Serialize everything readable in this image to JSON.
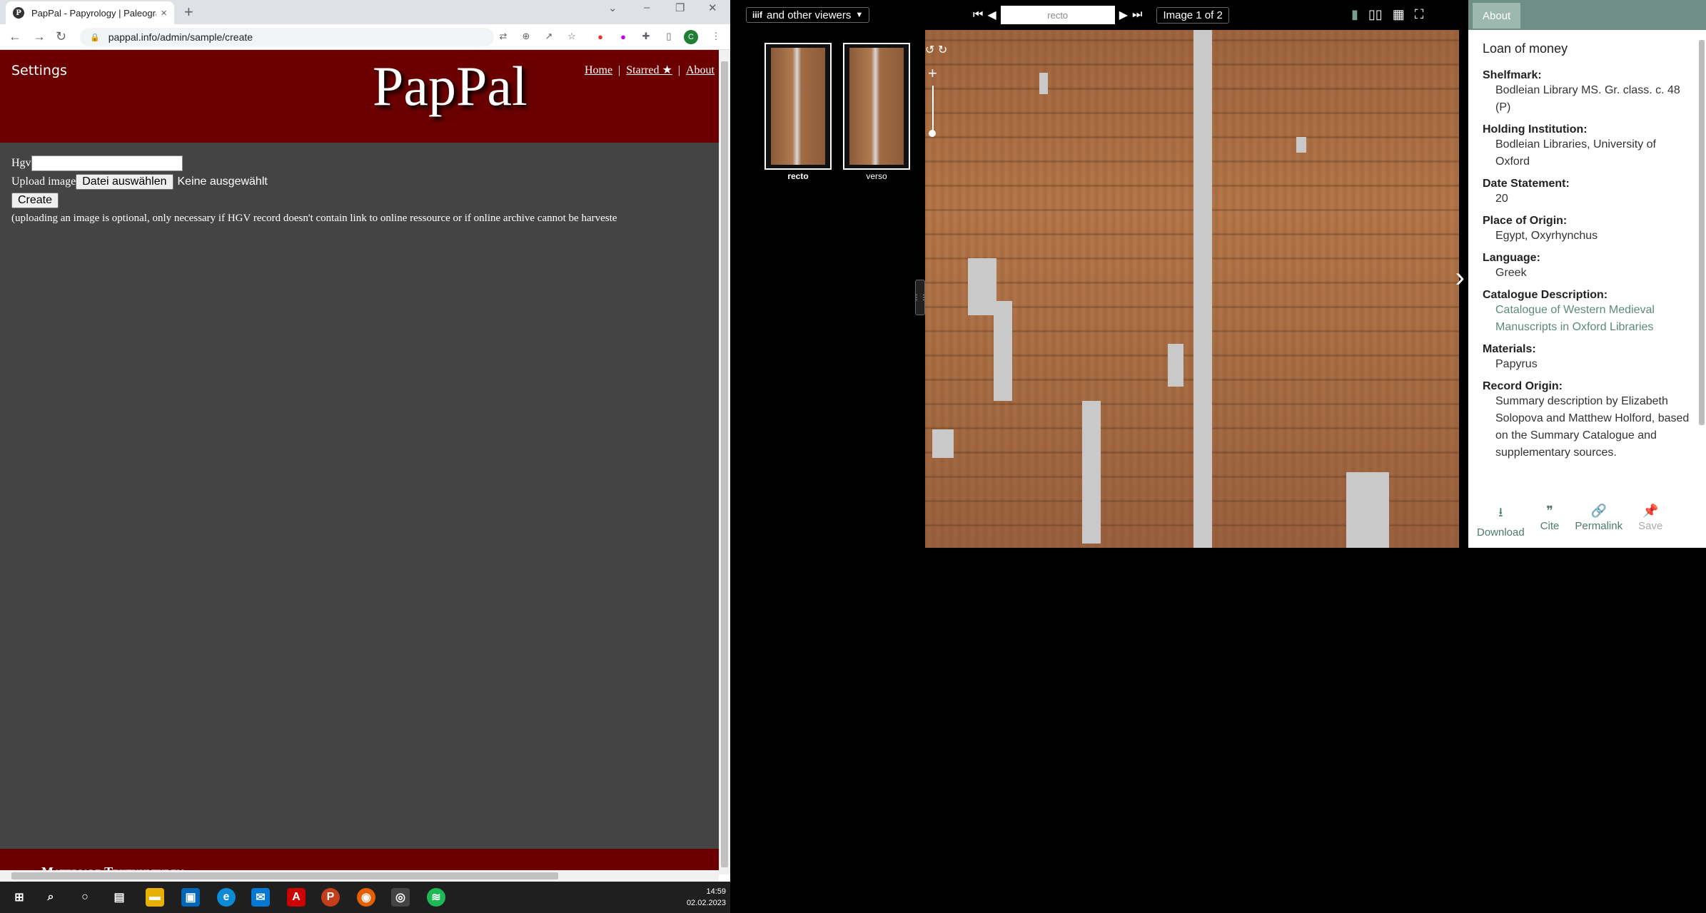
{
  "browser": {
    "tab_title": "PapPal - Papyrology | Paleograph...",
    "tab_close": "×",
    "new_tab": "+",
    "url": "pappal.info/admin/sample/create",
    "favicon_letter": "P",
    "profile_initial": "C"
  },
  "site": {
    "settings_label": "Settings",
    "logo_text": "PapPal",
    "nav": {
      "home": "Home",
      "starred": "Starred ★",
      "about": "About",
      "separator": "|"
    },
    "form": {
      "hgv_label": "Hgv",
      "hgv_value": "",
      "upload_label": "Upload image",
      "file_button": "Datei auswählen",
      "file_status": "Keine ausgewählt",
      "create_button": "Create",
      "note": "(uploading an image is optional, only necessary if HGV record doesn't contain link to online ressource or if online archive cannot be harveste"
    },
    "footer_text": "Materiale Textkulturen"
  },
  "taskbar": {
    "time": "14:59",
    "date": "02.02.2023"
  },
  "viewer": {
    "viewers_label": "and other viewers",
    "page_label": "recto",
    "image_count": "Image 1 of 2",
    "thumbnails": [
      {
        "label": "recto",
        "selected": true
      },
      {
        "label": "verso",
        "selected": false
      }
    ],
    "side_tab": "About",
    "manuscript_title": "Loan of money",
    "metadata": [
      {
        "label": "Shelfmark:",
        "value": "Bodleian Library MS. Gr. class. c. 48 (P)"
      },
      {
        "label": "Holding Institution:",
        "value": "Bodleian Libraries, University of Oxford"
      },
      {
        "label": "Date Statement:",
        "value": "20"
      },
      {
        "label": "Place of Origin:",
        "value": "Egypt, Oxyrhynchus"
      },
      {
        "label": "Language:",
        "value": "Greek"
      },
      {
        "label": "Catalogue Description:",
        "value": "Catalogue of Western Medieval Manuscripts in Oxford Libraries"
      },
      {
        "label": "Materials:",
        "value": "Papyrus"
      },
      {
        "label": "Record Origin:",
        "value": "Summary description by Elizabeth Solopova and Matthew Holford, based on the Summary Catalogue and supplementary sources."
      }
    ],
    "actions": {
      "download": "Download",
      "cite": "Cite",
      "permalink": "Permalink",
      "save": "Save"
    }
  },
  "colors": {
    "site_header": "#6b0000",
    "page_bg": "#444444",
    "mirador_accent": "#6f8f86",
    "link_teal": "#5b8a7c"
  }
}
